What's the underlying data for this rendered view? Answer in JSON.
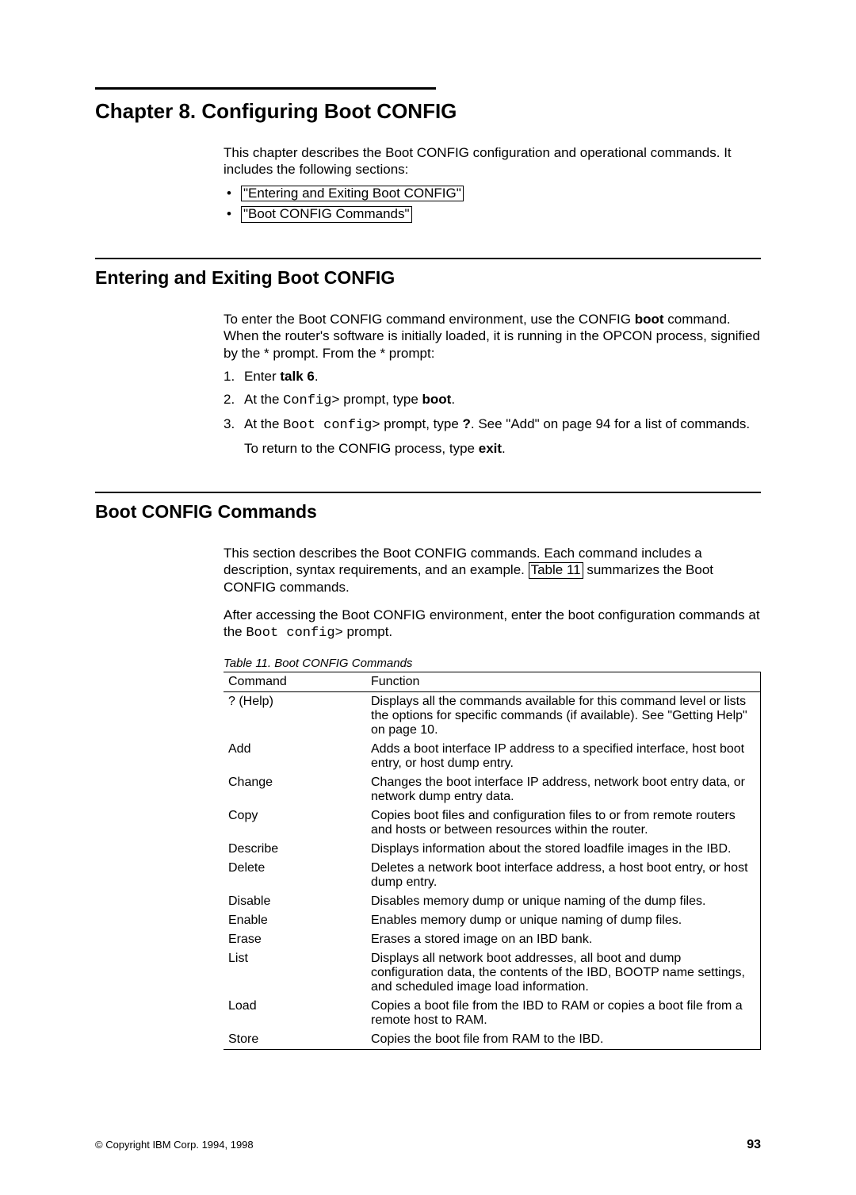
{
  "chapter": {
    "title": "Chapter 8. Configuring Boot CONFIG"
  },
  "intro": {
    "text": "This chapter describes the Boot CONFIG configuration and operational commands. It includes the following sections:",
    "links": [
      "\"Entering and Exiting Boot CONFIG\"",
      "\"Boot CONFIG Commands\""
    ]
  },
  "section1": {
    "heading": "Entering and Exiting Boot CONFIG",
    "p1_before": "To enter the Boot CONFIG command environment, use the CONFIG ",
    "p1_bold": "boot",
    "p1_after": " command. When the router's software is initially loaded, it is running in the OPCON process, signified by the * prompt. From the * prompt:",
    "steps": {
      "s1": {
        "num": "1.",
        "before": "Enter ",
        "bold": "talk 6",
        "after": "."
      },
      "s2": {
        "num": "2.",
        "before": "At the ",
        "mono": "Config>",
        "mid": " prompt, type ",
        "bold": "boot",
        "after": "."
      },
      "s3": {
        "num": "3.",
        "before": "At the ",
        "mono": "Boot config>",
        "mid": " prompt, type ",
        "bold": "?",
        "after": ". See \"Add\" on page 94 for a list of commands."
      },
      "return": {
        "before": "To return to the CONFIG process, type ",
        "bold": "exit",
        "after": "."
      }
    }
  },
  "section2": {
    "heading": "Boot CONFIG Commands",
    "p1_before": "This section describes the Boot CONFIG commands. Each command includes a description, syntax requirements, and an example. ",
    "p1_link": "Table 11",
    "p1_after": " summarizes the Boot CONFIG commands.",
    "p2_before": "After accessing the Boot CONFIG environment, enter the boot configuration commands at the ",
    "p2_mono": "Boot config>",
    "p2_after": " prompt.",
    "table": {
      "caption": "Table 11. Boot CONFIG Commands",
      "head": {
        "cmd": "Command",
        "func": "Function"
      },
      "rows": [
        {
          "cmd": "? (Help)",
          "func": "Displays all the commands available for this command level or lists the options for specific commands (if available). See \"Getting Help\" on page 10."
        },
        {
          "cmd": "Add",
          "func": "Adds a boot interface IP address to a specified interface, host boot entry, or host dump entry."
        },
        {
          "cmd": "Change",
          "func": "Changes the boot interface IP address, network boot entry data, or network dump entry data."
        },
        {
          "cmd": "Copy",
          "func": "Copies boot files and configuration files to or from remote routers and hosts or between resources within the router."
        },
        {
          "cmd": "Describe",
          "func": "Displays information about the stored loadfile images in the IBD."
        },
        {
          "cmd": "Delete",
          "func": "Deletes a network boot interface address, a host boot entry, or host dump entry."
        },
        {
          "cmd": "Disable",
          "func": "Disables memory dump or unique naming of the dump files."
        },
        {
          "cmd": "Enable",
          "func": "Enables memory dump or unique naming of dump files."
        },
        {
          "cmd": "Erase",
          "func": "Erases a stored image on an IBD bank."
        },
        {
          "cmd": "List",
          "func": "Displays all network boot addresses, all boot and dump configuration data, the contents of the IBD, BOOTP name settings, and scheduled image load information."
        },
        {
          "cmd": "Load",
          "func": "Copies a boot file from the IBD to RAM or copies a boot file from a remote host to RAM."
        },
        {
          "cmd": "Store",
          "func": "Copies the boot file from RAM to the IBD."
        }
      ]
    }
  },
  "footer": {
    "copyright": "© Copyright IBM Corp. 1994, 1998",
    "pagenum": "93"
  }
}
